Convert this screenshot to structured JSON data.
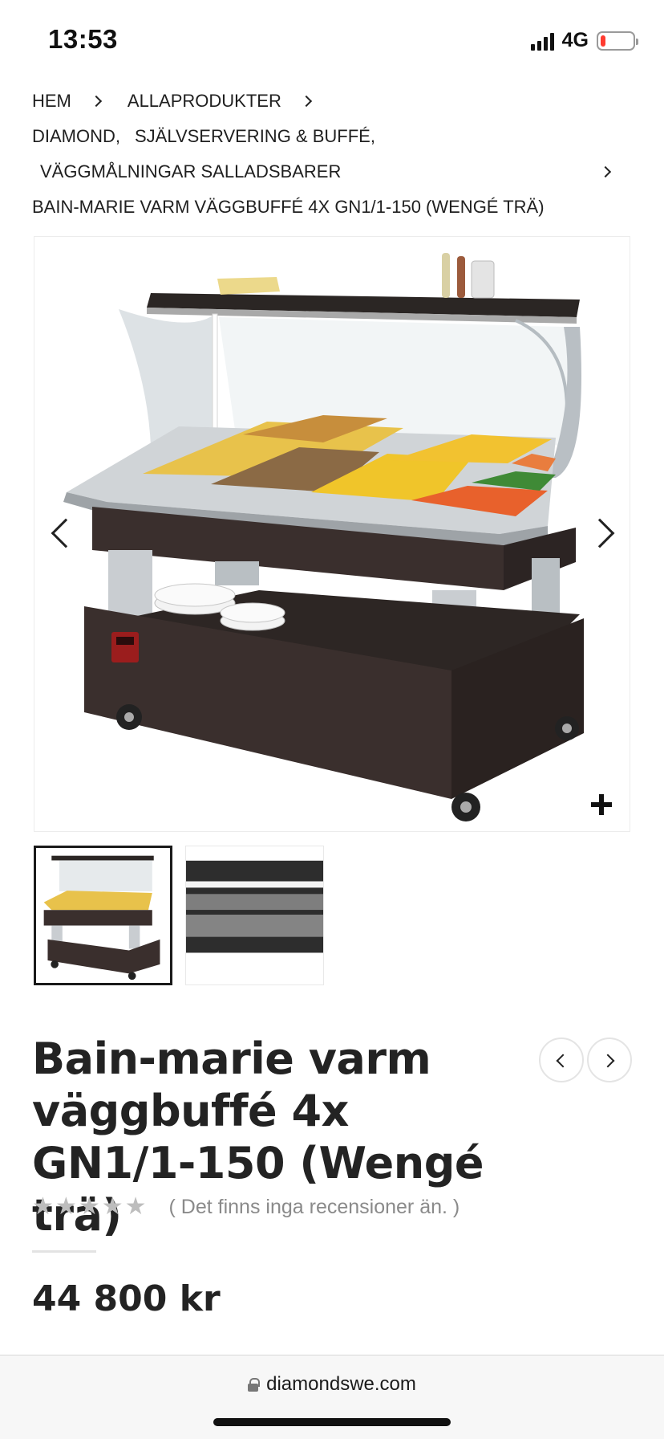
{
  "status_bar": {
    "time": "13:53",
    "network": "4G",
    "battery_level": 0.15,
    "battery_color": "#ff3b30",
    "signal_bars": 4
  },
  "breadcrumb": {
    "items": [
      "HEM",
      "ALLAPRODUKTER"
    ],
    "categories": [
      "DIAMOND,",
      "SJÄLVSERVERING & BUFFÉ,",
      "VÄGGMÅLNINGAR SALLADSBARER"
    ],
    "current": "BAIN-MARIE VARM VÄGGBUFFÉ 4X GN1/1-150 (WENGÉ TRÄ)"
  },
  "gallery": {
    "main_image": "Bain-marie buffet trolley (wenge wood, glass sneeze guard, food pans)",
    "prev_icon": "chevron-left-icon",
    "next_icon": "chevron-right-icon",
    "zoom_icon": "plus-icon",
    "thumbnails": [
      {
        "label": "Bain-marie product thumbnail",
        "active": true
      },
      {
        "label": "LED lighting detail thumbnail",
        "active": false
      }
    ]
  },
  "product": {
    "title": "Bain-marie varm väggbuffé 4x GN1/1-150 (Wengé trä)",
    "rating": 0,
    "max_rating": 5,
    "review_text": "( Det finns inga recensioner än. )",
    "price": "44 800 kr"
  },
  "browser": {
    "url": "diamondswe.com"
  },
  "colors": {
    "wood": "#3a2f2d",
    "steel": "#c9cdd1",
    "star_empty": "#bdbdbd",
    "text": "#232323"
  }
}
